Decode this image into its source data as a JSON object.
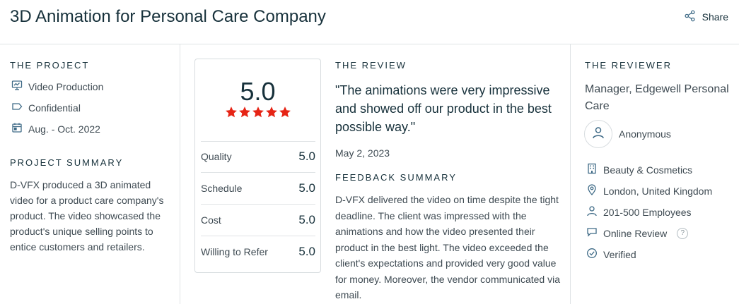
{
  "header": {
    "title": "3D Animation for Personal Care Company",
    "share_label": "Share"
  },
  "project": {
    "heading": "THE PROJECT",
    "items": [
      {
        "icon": "monitor-icon",
        "label": "Video Production"
      },
      {
        "icon": "tag-icon",
        "label": "Confidential"
      },
      {
        "icon": "calendar-icon",
        "label": "Aug. - Oct. 2022"
      }
    ],
    "summary_heading": "PROJECT SUMMARY",
    "summary": "D-VFX produced a 3D animated video for a product care company's product. The video showcased the product's unique selling points to entice customers and retailers."
  },
  "rating": {
    "overall": "5.0",
    "stars": 5,
    "rows": [
      {
        "label": "Quality",
        "value": "5.0"
      },
      {
        "label": "Schedule",
        "value": "5.0"
      },
      {
        "label": "Cost",
        "value": "5.0"
      },
      {
        "label": "Willing to Refer",
        "value": "5.0"
      }
    ]
  },
  "review": {
    "heading": "THE REVIEW",
    "quote": "\"The animations were very impressive and showed off our product in the best possible way.\"",
    "date": "May 2, 2023",
    "feedback_heading": "FEEDBACK SUMMARY",
    "feedback": "D-VFX delivered the video on time despite the tight deadline. The client was impressed with the animations and how the video presented their product in the best light. The video exceeded the client's expectations and provided very good value for money. Moreover, the vendor communicated via email."
  },
  "reviewer": {
    "heading": "THE REVIEWER",
    "name": "Manager, Edgewell Personal Care",
    "anonymous": "Anonymous",
    "details": [
      {
        "icon": "building-icon",
        "label": "Beauty & Cosmetics"
      },
      {
        "icon": "location-pin-icon",
        "label": "London, United Kingdom"
      },
      {
        "icon": "person-icon",
        "label": "201-500 Employees"
      },
      {
        "icon": "chat-bubble-icon",
        "label": "Online Review",
        "help": "?"
      },
      {
        "icon": "check-circle-icon",
        "label": "Verified"
      }
    ]
  },
  "colors": {
    "star": "#e62415",
    "text_dark": "#17313b",
    "text_body": "#3e4a52",
    "icon": "#3e6a86",
    "divider": "#dfe3e5"
  }
}
